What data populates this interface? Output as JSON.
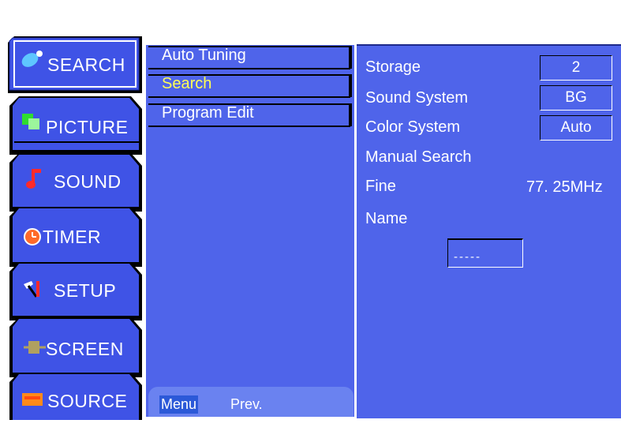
{
  "tabs": [
    {
      "label": "SEARCH",
      "icon": "satellite-dish-icon",
      "selected": true
    },
    {
      "label": "PICTURE",
      "icon": "picture-icon",
      "selected": false
    },
    {
      "label": "SOUND",
      "icon": "music-note-icon",
      "selected": false
    },
    {
      "label": "TIMER",
      "icon": "alarm-clock-icon",
      "selected": false
    },
    {
      "label": "SETUP",
      "icon": "tools-icon",
      "selected": false
    },
    {
      "label": "SCREEN",
      "icon": "screen-icon",
      "selected": false
    },
    {
      "label": "SOURCE",
      "icon": "source-icon",
      "selected": false
    }
  ],
  "submenu": {
    "items": [
      {
        "label": "Auto Tuning",
        "selected": false
      },
      {
        "label": "Search",
        "selected": true
      },
      {
        "label": "Program Edit",
        "selected": false
      }
    ]
  },
  "footer": {
    "menu_label": "Menu",
    "prev_label": "Prev."
  },
  "settings": {
    "storage": {
      "label": "Storage",
      "value": "2"
    },
    "sound_system": {
      "label": "Sound System",
      "value": "BG"
    },
    "color_system": {
      "label": "Color System",
      "value": "Auto"
    },
    "manual_search": {
      "label": "Manual Search"
    },
    "fine": {
      "label": "Fine",
      "value": "77. 25MHz"
    },
    "name": {
      "label": "Name",
      "value": "-----"
    }
  },
  "colors": {
    "panel": "#4f64ea",
    "tab": "#3f53e6",
    "selected_text": "#ffff55",
    "footer": "#6a82f0"
  }
}
